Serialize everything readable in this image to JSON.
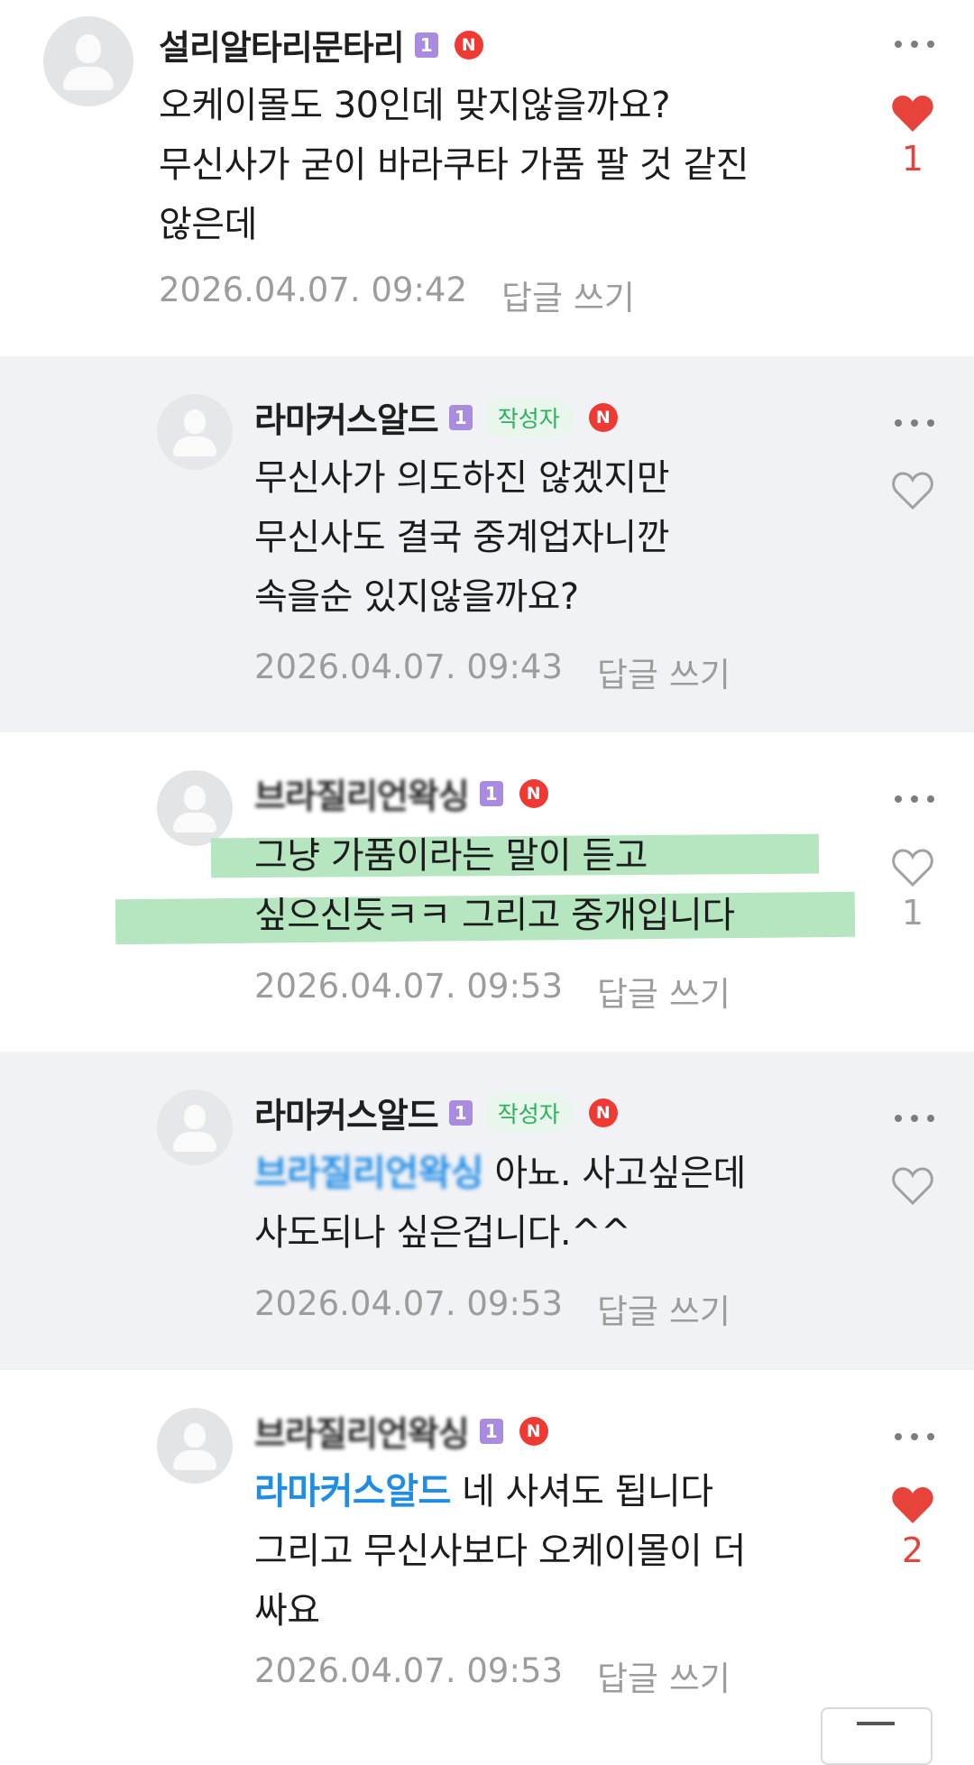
{
  "comments": [
    {
      "nickname": "설리알타리문타리",
      "level": "1",
      "n_badge": "N",
      "text": "오케이몰도 30인데 맞지않을까요?\n무신사가 굳이 바라쿠타 가품 팔 것 같진\n않은데",
      "timestamp": "2026.04.07. 09:42",
      "reply_label": "답글 쓰기",
      "liked": true,
      "like_count": "1"
    },
    {
      "nickname": "라마커스알드",
      "level": "1",
      "author_badge": "작성자",
      "n_badge": "N",
      "text": "무신사가 의도하진 않겠지만\n무신사도 결국 중계업자니깐\n속을순 있지않을까요?",
      "timestamp": "2026.04.07. 09:43",
      "reply_label": "답글 쓰기",
      "liked": false,
      "like_count": ""
    },
    {
      "nickname": "브라질리언왁싱",
      "level": "1",
      "n_badge": "N",
      "text": "그냥 가품이라는 말이 듣고\n싶으신듯ㅋㅋ 그리고 중개입니다",
      "timestamp": "2026.04.07. 09:53",
      "reply_label": "답글 쓰기",
      "liked": false,
      "like_count": "1"
    },
    {
      "nickname": "라마커스알드",
      "level": "1",
      "author_badge": "작성자",
      "n_badge": "N",
      "mention": "브라질리언왁싱",
      "text": "아뇨. 사고싶은데\n사도되나 싶은겁니다.^^",
      "timestamp": "2026.04.07. 09:53",
      "reply_label": "답글 쓰기",
      "liked": false,
      "like_count": ""
    },
    {
      "nickname": "브라질리언왁싱",
      "level": "1",
      "n_badge": "N",
      "mention": "라마커스알드",
      "text": "네 사셔도 됩니다\n그리고 무신사보다 오케이몰이 더\n싸요",
      "timestamp": "2026.04.07. 09:53",
      "reply_label": "답글 쓰기",
      "liked": true,
      "like_count": "2"
    }
  ],
  "colors": {
    "accent_red": "#e8433a",
    "mention_blue": "#1f8ce6",
    "author_green": "#2bb060",
    "level_purple": "#a98be0",
    "highlight_green": "#b6e6c0"
  },
  "icons": [
    "avatar",
    "level-badge",
    "n-badge",
    "more-icon",
    "heart-icon"
  ]
}
